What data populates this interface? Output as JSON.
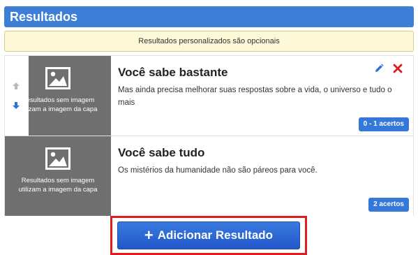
{
  "header": {
    "title": "Resultados"
  },
  "notice": {
    "text": "Resultados personalizados são opcionais"
  },
  "results": [
    {
      "title": "Você sabe bastante",
      "description": "Mas ainda precisa melhorar suas respostas sobre a vida, o universo e tudo o mais",
      "badge": "0 - 1 acertos",
      "thumb_line1": "Resultados sem imagem",
      "thumb_line2": "utilizam a imagem da capa"
    },
    {
      "title": "Você sabe tudo",
      "description": "Os mistérios da humanidade não são páreos para você.",
      "badge": "2 acertos",
      "thumb_line1": "Resultados sem imagem",
      "thumb_line2": "utilizam a imagem da capa"
    }
  ],
  "add_button": {
    "label": "Adicionar Resultado"
  },
  "colors": {
    "accent": "#3d7fd6",
    "danger": "#dd1c1c",
    "notice_bg": "#fcf8d8"
  }
}
